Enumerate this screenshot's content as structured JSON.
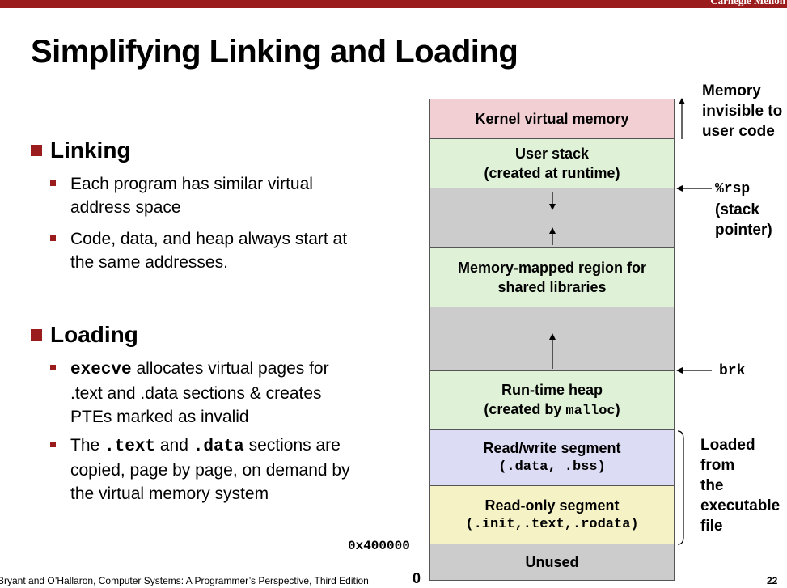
{
  "header": {
    "brand": "Carnegie Mellon"
  },
  "slide": {
    "title": "Simplifying Linking and Loading",
    "linking": {
      "heading": "Linking",
      "points": [
        "Each program has similar virtual address space",
        "Code, data, and heap always start at the same addresses."
      ]
    },
    "loading": {
      "heading": "Loading",
      "point1": {
        "code": "execve",
        "text": " allocates virtual pages for .text and .data sections & creates PTEs marked as invalid"
      },
      "point2": {
        "pre": "The ",
        "code1": ".text",
        "mid": " and ",
        "code2": ".data",
        "post": " sections are copied, page by page, on demand by the virtual memory system"
      }
    }
  },
  "memory": {
    "kernel": "Kernel virtual memory",
    "user_stack": [
      "User stack",
      "(created at runtime)"
    ],
    "mmap": [
      "Memory-mapped region for",
      "shared libraries"
    ],
    "heap": {
      "line1": "Run-time heap",
      "line2_pre": "(created by ",
      "line2_code": "malloc",
      "line2_post": ")"
    },
    "rw": {
      "line1": "Read/write segment",
      "line2": "(.data, .bss)"
    },
    "ro": {
      "line1": "Read-only segment",
      "line2": "(.init,.text,.rodata)"
    },
    "unused": "Unused",
    "colors": {
      "kernel": "#f2cfd3",
      "green": "#dff2d8",
      "gray": "#cccccc",
      "rw": "#dcdcf5",
      "ro": "#f5f2c6",
      "unused": "#cccccc"
    }
  },
  "labels": {
    "invisible": [
      "Memory",
      "invisible to",
      "user code"
    ],
    "rsp": {
      "code": "%rsp",
      "line2": "(stack",
      "line3": "pointer)"
    },
    "brk": "brk",
    "loaded": [
      "Loaded",
      "from",
      "the",
      "executable",
      "file"
    ]
  },
  "addresses": {
    "start": "0x400000",
    "zero": "0"
  },
  "footer": {
    "citation": "Bryant and O’Hallaron, Computer Systems: A Programmer’s Perspective, Third Edition",
    "page": "22"
  }
}
